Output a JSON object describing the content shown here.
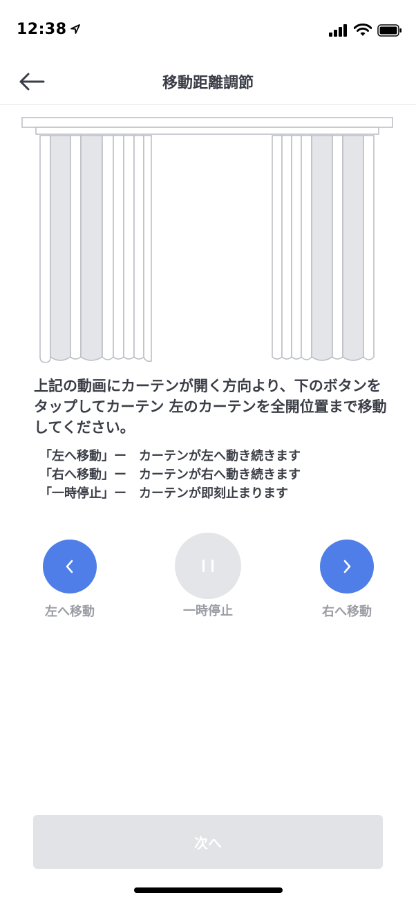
{
  "status_bar": {
    "time": "12:38",
    "icons": [
      "location-arrow-icon",
      "cellular-signal-icon",
      "wifi-icon",
      "battery-icon"
    ]
  },
  "nav": {
    "back_icon": "arrow-left-icon",
    "title": "移動距離調節"
  },
  "instruction": "上記の動画にカーテンが開く方向より、下のボタンをタップしてカーテン 左のカーテンを全開位置まで移動してください。",
  "legend": [
    "「左へ移動」ー　カーテンが左へ動き続きます",
    "「右へ移動」ー　カーテンが右へ動き続きます",
    "「一時停止」ー　カーテンが即刻止まります"
  ],
  "controls": {
    "left_label": "左へ移動",
    "pause_label": "一時停止",
    "right_label": "右へ移動",
    "left_icon": "chevron-left-icon",
    "pause_icon": "pause-icon",
    "right_icon": "chevron-right-icon"
  },
  "next_button": "次へ",
  "colors": {
    "accent": "#4f7ee8",
    "disabled": "#e1e3e6",
    "text": "#3a3d46",
    "label_muted": "#9a9ca3"
  }
}
